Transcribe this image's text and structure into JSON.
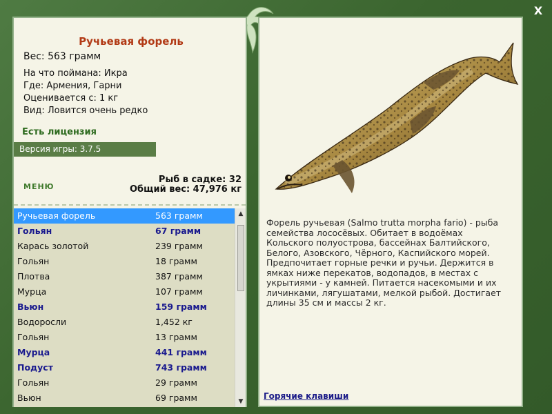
{
  "window": {
    "close_label": "X"
  },
  "fish": {
    "name": "Ручьевая форель",
    "weight_line": "Вес: 563 грамм",
    "caught_on": "На что поймана: Икра",
    "where": "Где: Армения, Гарни",
    "valued_from": "Оценивается с: 1 кг",
    "view": "Вид: Ловится очень редко"
  },
  "license": "Есть лицензия",
  "version": "Версия игры: 3.7.5",
  "menu_label": "МЕНЮ",
  "stats": {
    "count": "Рыб в садке: 32",
    "total_weight": "Общий вес: 47,976 кг"
  },
  "list": [
    {
      "name": "Ручьевая форель",
      "weight": "563 грамм",
      "bold": false,
      "selected": true
    },
    {
      "name": "Гольян",
      "weight": "67 грамм",
      "bold": true,
      "selected": false
    },
    {
      "name": "Карась золотой",
      "weight": "239 грамм",
      "bold": false,
      "selected": false
    },
    {
      "name": "Гольян",
      "weight": "18 грамм",
      "bold": false,
      "selected": false
    },
    {
      "name": "Плотва",
      "weight": "387 грамм",
      "bold": false,
      "selected": false
    },
    {
      "name": "Мурца",
      "weight": "107 грамм",
      "bold": false,
      "selected": false
    },
    {
      "name": "Вьюн",
      "weight": "159 грамм",
      "bold": true,
      "selected": false
    },
    {
      "name": "Водоросли",
      "weight": "1,452 кг",
      "bold": false,
      "selected": false
    },
    {
      "name": "Гольян",
      "weight": "13 грамм",
      "bold": false,
      "selected": false
    },
    {
      "name": "Мурца",
      "weight": "441 грамм",
      "bold": true,
      "selected": false
    },
    {
      "name": "Подуст",
      "weight": "743 грамм",
      "bold": true,
      "selected": false
    },
    {
      "name": "Гольян",
      "weight": "29 грамм",
      "bold": false,
      "selected": false
    },
    {
      "name": "Вьюн",
      "weight": "69 грамм",
      "bold": false,
      "selected": false
    }
  ],
  "description": "Форель ручьевая (Salmo trutta morpha fario) - рыба семейства лососёвых. Обитает в водоёмах Кольского полуострова, бассейнах Балтийского, Белого, Азовского, Чёрного, Каспийского морей. Предпочитает горные речки и ручьи. Держится в ямках ниже перекатов, водопадов, в местах с укрытиями - у камней. Питается насекомыми и их личинками, лягушатами, мелкой рыбой. Достигает длины 35 см и массы 2 кг.",
  "hotkeys_label": "Горячие клавиши"
}
